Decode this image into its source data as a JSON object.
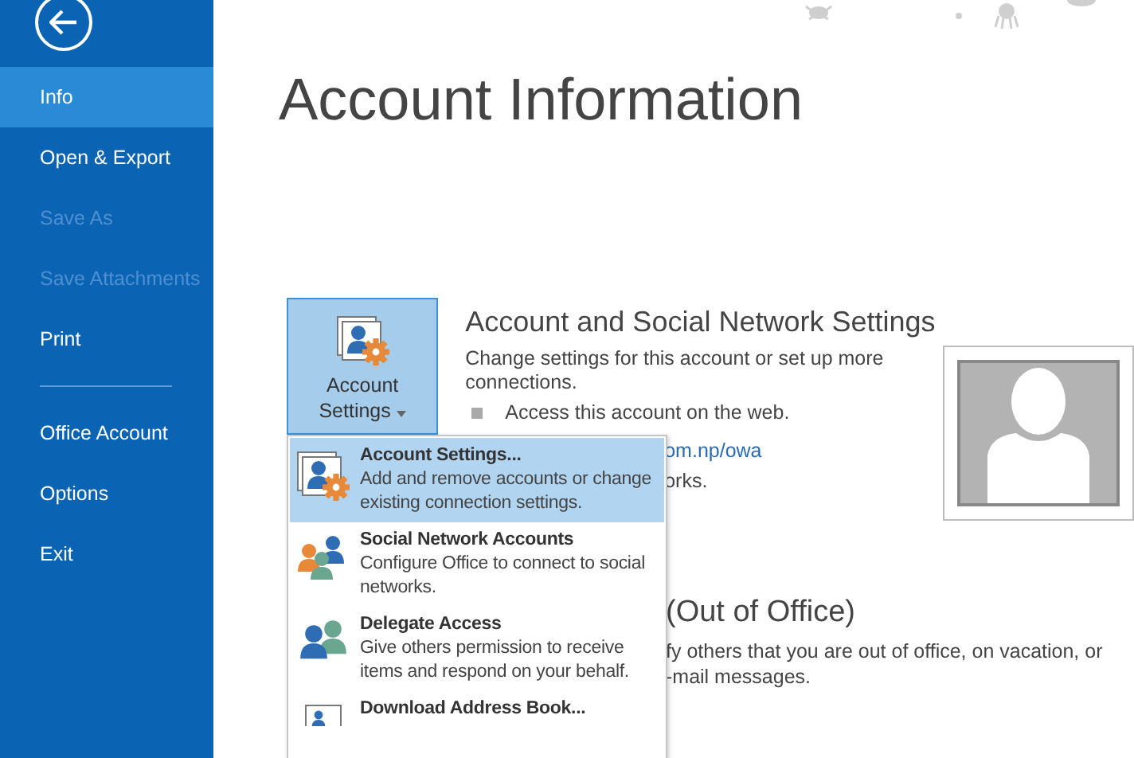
{
  "sidebar": {
    "items": [
      {
        "kind": "item",
        "label": "Info",
        "selected": true,
        "disabled": false
      },
      {
        "kind": "item",
        "label": "Open & Export",
        "selected": false,
        "disabled": false
      },
      {
        "kind": "item",
        "label": "Save As",
        "selected": false,
        "disabled": true
      },
      {
        "kind": "item",
        "label": "Save Attachments",
        "selected": false,
        "disabled": true
      },
      {
        "kind": "item",
        "label": "Print",
        "selected": false,
        "disabled": false
      },
      {
        "kind": "divider"
      },
      {
        "kind": "item",
        "label": "Office Account",
        "selected": false,
        "disabled": false
      },
      {
        "kind": "item",
        "label": "Options",
        "selected": false,
        "disabled": false
      },
      {
        "kind": "item",
        "label": "Exit",
        "selected": false,
        "disabled": false
      }
    ]
  },
  "page_title": "Account Information",
  "account_section": {
    "button": {
      "line_1": "Account",
      "line_2": "Settings"
    },
    "heading": "Account and Social Network Settings",
    "description": "Change settings for this account or set up more connections.",
    "bullet": "Access this account on the web.",
    "link_fragment": "om.np/owa",
    "text_fragment": "orks."
  },
  "auto_reply_section": {
    "heading_fragment": "(Out of Office)",
    "lines": [
      "fy others that you are out of office, on vacation, or",
      "-mail messages."
    ]
  },
  "dropdown": {
    "items": [
      {
        "kind": "account-settings",
        "title": "Account Settings...",
        "description": "Add and remove accounts or change existing connection settings.",
        "selected": true
      },
      {
        "kind": "social",
        "title": "Social Network Accounts",
        "description": "Configure Office to connect to social networks.",
        "selected": false
      },
      {
        "kind": "delegate",
        "title": "Delegate Access",
        "description": "Give others permission to receive items and respond on your behalf.",
        "selected": false
      },
      {
        "kind": "address-book",
        "title": "Download Address Book...",
        "selected": false
      }
    ]
  }
}
